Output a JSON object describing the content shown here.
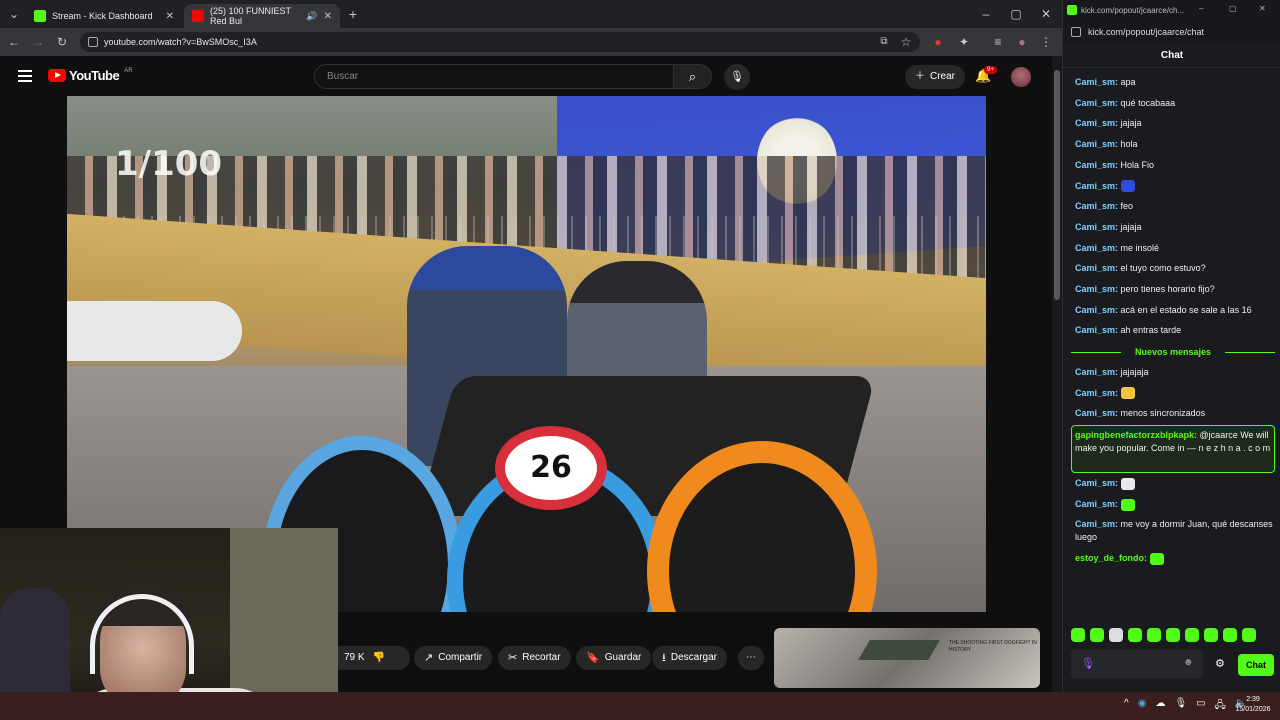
{
  "browser": {
    "tabs": [
      {
        "title": "Stream - Kick Dashboard",
        "active": false,
        "favicon_color": "#53fc18"
      },
      {
        "title": "(25) 100 FUNNIEST Red Bul",
        "active": true,
        "favicon_color": "#ff0000"
      }
    ],
    "url": "youtube.com/watch?v=BwSMOsc_I3A"
  },
  "youtube": {
    "logo_text": "YouTube",
    "country": "AR",
    "search_placeholder": "Buscar",
    "create_label": "Crear",
    "notifications_badge": "9+"
  },
  "video": {
    "counter": "1/100",
    "plate_number": "26"
  },
  "actions": {
    "likes": "79 K",
    "share": "Compartir",
    "clip": "Recortar",
    "save": "Guardar",
    "download": "Descargar",
    "more": "⋯"
  },
  "recommended": {
    "thumb_text": "THE SHOOTING FIRST DOGFIGHT IN HISTORY"
  },
  "chat_window": {
    "title_url": "kick.com/popout/jcaarce/ch...",
    "url": "kick.com/popout/jcaarce/chat",
    "header": "Chat",
    "new_messages_label": "Nuevos mensajes",
    "send_label": "Chat",
    "messages_before": [
      {
        "user": "Cami_sm:",
        "text": "apa"
      },
      {
        "user": "Cami_sm:",
        "text": "qué tocabaaa"
      },
      {
        "user": "Cami_sm:",
        "text": "jajaja"
      },
      {
        "user": "Cami_sm:",
        "text": "hola"
      },
      {
        "user": "Cami_sm:",
        "text": "Hola Fio"
      },
      {
        "user": "Cami_sm:",
        "text": ""
      },
      {
        "user": "Cami_sm:",
        "text": "feo"
      },
      {
        "user": "Cami_sm:",
        "text": "jajaja"
      },
      {
        "user": "Cami_sm:",
        "text": "me insolé"
      },
      {
        "user": "Cami_sm:",
        "text": "el tuyo como estuvo?"
      },
      {
        "user": "Cami_sm:",
        "text": "pero tienes horario fijo?"
      },
      {
        "user": "Cami_sm:",
        "text": "acá en el estado se sale a las 16"
      },
      {
        "user": "Cami_sm:",
        "text": "ah entras tarde"
      }
    ],
    "messages_after": [
      {
        "user": "Cami_sm:",
        "text": "jajajaja"
      },
      {
        "user": "Cami_sm:",
        "text": ""
      },
      {
        "user": "Cami_sm:",
        "text": "menos sincronizados"
      }
    ],
    "highlighted": {
      "user": "gapingbenefactorzxblpkapk:",
      "text": "@jcaarce We will make you popular. Come in — n e z h n a . c o m"
    },
    "messages_tail": [
      {
        "user": "Cami_sm:",
        "text": ""
      },
      {
        "user": "Cami_sm:",
        "text": ""
      },
      {
        "user": "Cami_sm:",
        "text": "me voy a dormir Juan, qué descanses luego"
      },
      {
        "user": "estoy_de_fondo:",
        "text": ""
      }
    ]
  },
  "taskbar": {
    "time": "2:39",
    "date": "15/01/2026"
  },
  "colors": {
    "kick_green": "#53fc18",
    "youtube_red": "#ff0000",
    "chat_username": "#7ed0ff"
  }
}
